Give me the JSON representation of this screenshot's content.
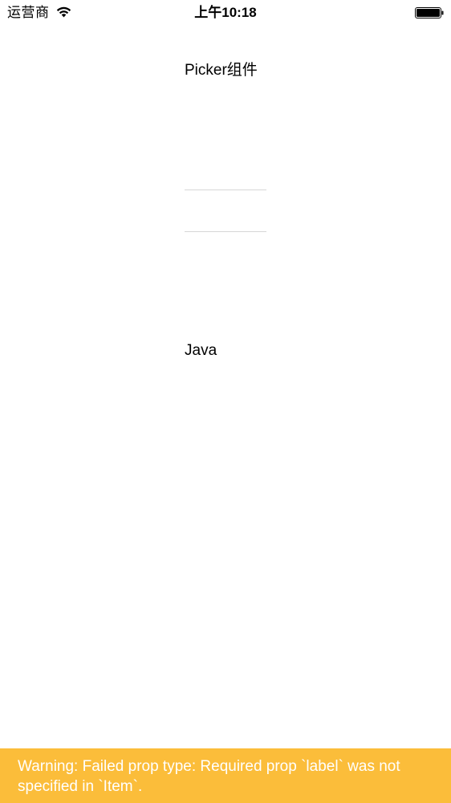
{
  "status_bar": {
    "carrier": "运营商",
    "wifi_icon": "wifi-icon",
    "time": "上午10:18",
    "battery_icon": "battery-full-icon"
  },
  "main": {
    "title": "Picker组件",
    "picker": {
      "options": [],
      "selected_index": null
    },
    "selected_value": "Java"
  },
  "warning": {
    "text": "Warning: Failed prop type: Required prop `label` was not specified in `Item`.",
    "background_color": "#fbbd3a",
    "text_color": "#ffffff"
  }
}
